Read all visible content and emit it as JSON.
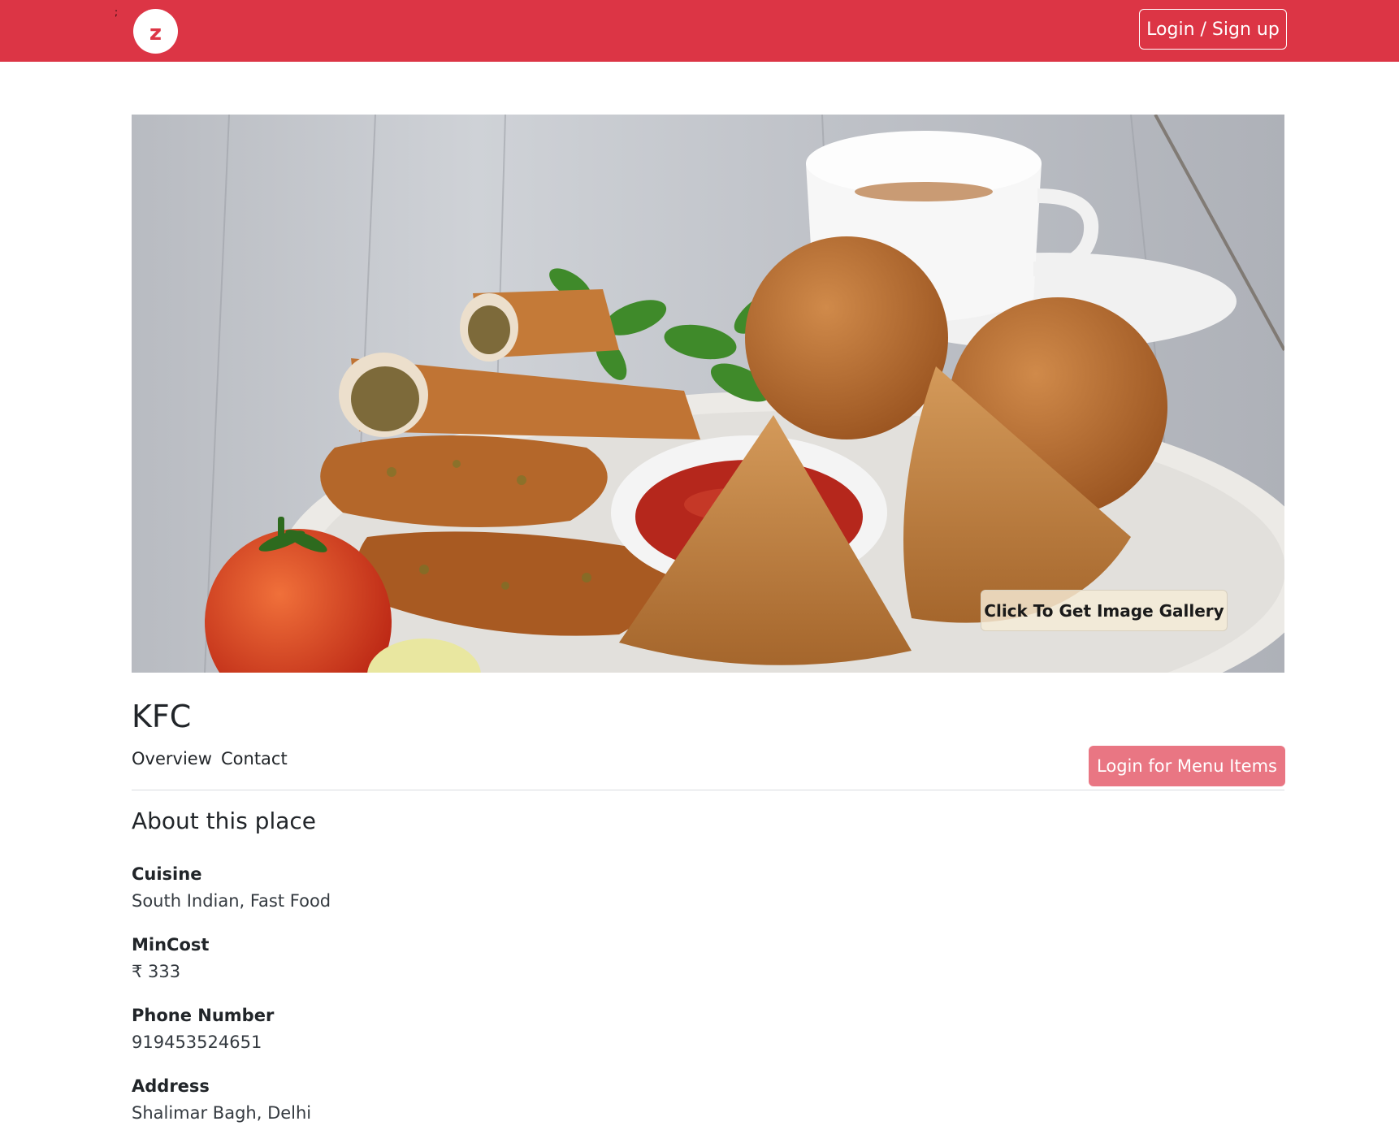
{
  "header": {
    "mark": ";",
    "logo_letter": "z",
    "login_label": "Login / Sign up"
  },
  "hero": {
    "image_icon": "food-platter-photo",
    "gallery_label": "Click To Get Image Gallery"
  },
  "restaurant": {
    "name": "KFC",
    "tabs": [
      {
        "label": "Overview"
      },
      {
        "label": "Contact"
      }
    ],
    "menu_button_label": "Login for Menu Items"
  },
  "about": {
    "title": "About this place",
    "fields": [
      {
        "label": "Cuisine",
        "value": "South Indian, Fast Food"
      },
      {
        "label": "MinCost",
        "value": "₹ 333"
      },
      {
        "label": "Phone Number",
        "value": "919453524651"
      },
      {
        "label": "Address",
        "value": "Shalimar Bagh, Delhi"
      }
    ]
  },
  "colors": {
    "brand_red": "#dc3545",
    "menu_button": "#e97683"
  }
}
